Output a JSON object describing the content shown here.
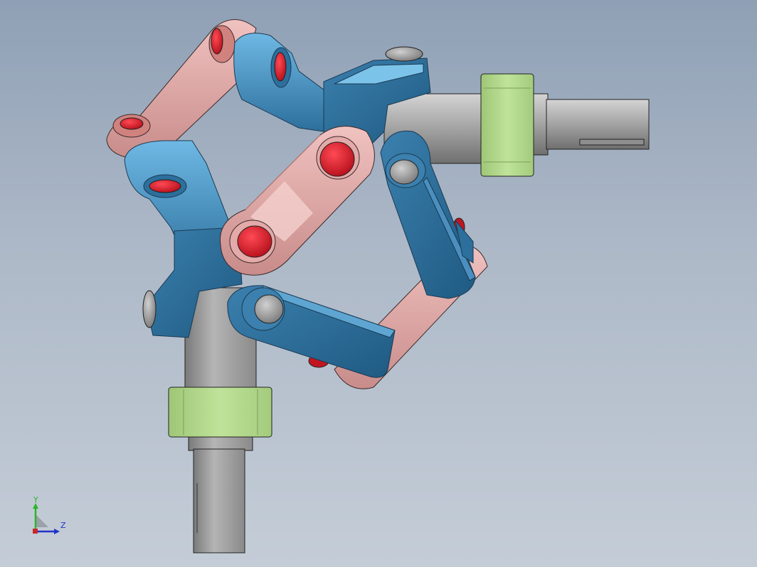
{
  "viewport": {
    "background_top": "#8fa0b5",
    "background_bottom": "#c4cdd7"
  },
  "model": {
    "parts": [
      "input-shaft",
      "output-shaft",
      "bearing-block",
      "bearing-block",
      "yoke",
      "yoke",
      "crank-link",
      "crank-link",
      "crank-link",
      "coupler-link",
      "pin",
      "pin"
    ],
    "colors": {
      "shaft_gray": "#9a9a9a",
      "bearing_green": "#b4d98d",
      "yoke_blue": "#3f86b6",
      "link_pink": "#e3aaa9",
      "pin_red": "#e0202c"
    }
  },
  "triad": {
    "y_label": "Y",
    "z_label": "Z",
    "y_color": "#2bb52b",
    "z_color": "#2233c8"
  }
}
